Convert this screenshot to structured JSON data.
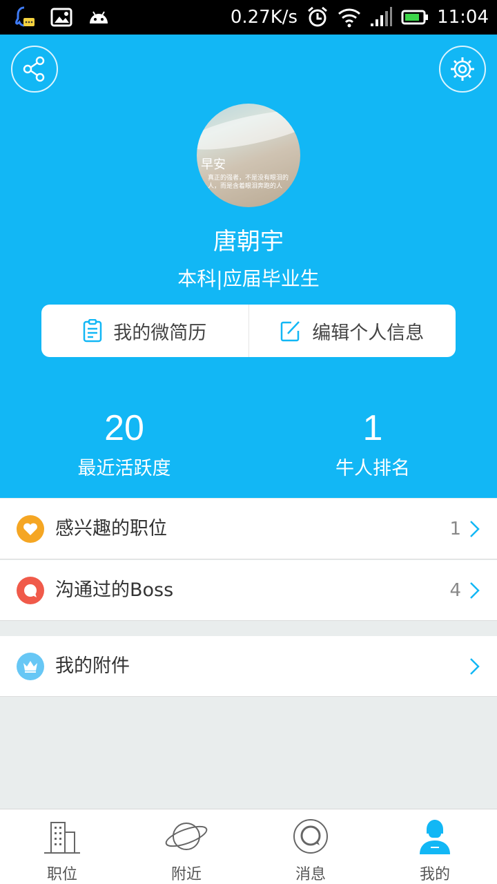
{
  "statusbar": {
    "speed": "0.27K/s",
    "time": "11:04"
  },
  "header": {
    "avatar_text_1": "早安",
    "avatar_text_2": "真正的强者，不是没有眼泪的人，而是含着眼泪奔跑的人",
    "name": "唐朝宇",
    "subtitle": "本科|应届毕业生",
    "resume_label": "我的微简历",
    "edit_label": "编辑个人信息",
    "stats": [
      {
        "value": "20",
        "label": "最近活跃度"
      },
      {
        "value": "1",
        "label": "牛人排名"
      }
    ]
  },
  "list": [
    {
      "label": "感兴趣的职位",
      "count": "1",
      "color": "#f5a623"
    },
    {
      "label": "沟通过的Boss",
      "count": "4",
      "color": "#f05a4a"
    },
    {
      "label": "我的附件",
      "count": "",
      "color": "#67c7f5"
    }
  ],
  "bottom_nav": {
    "items": [
      {
        "label": "职位"
      },
      {
        "label": "附近"
      },
      {
        "label": "消息"
      },
      {
        "label": "我的"
      }
    ],
    "active_color": "#12b7f5"
  },
  "colors": {
    "accent": "#12b7f5",
    "background": "#e9eded"
  }
}
